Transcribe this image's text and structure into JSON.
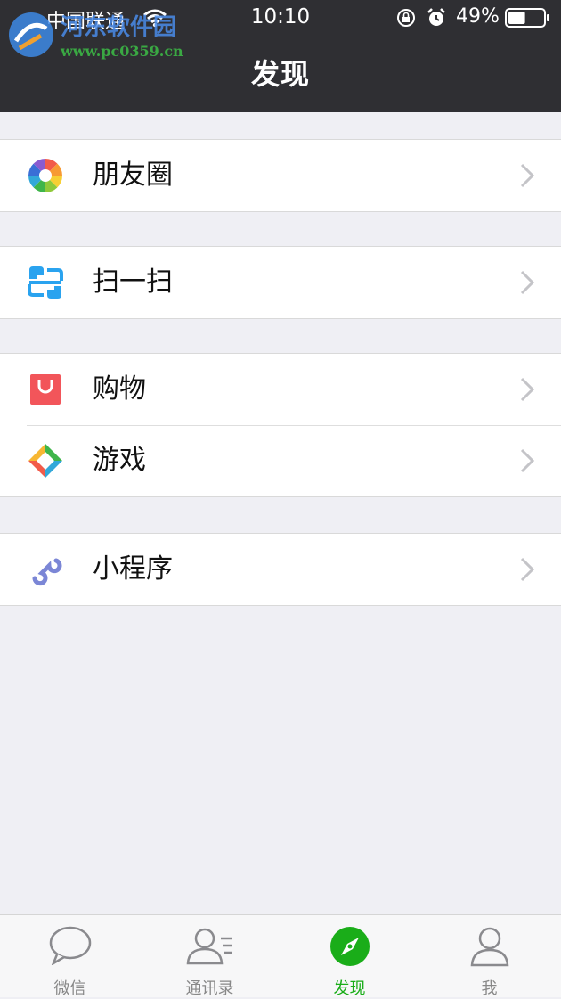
{
  "status_bar": {
    "carrier": "中国联通",
    "time": "10:10",
    "battery": "49%",
    "battery_level": 0.49
  },
  "watermark": {
    "text": "河东软件园",
    "url": "www.pc0359.cn"
  },
  "header": {
    "title": "发现"
  },
  "menu_groups": [
    [
      {
        "label": "朋友圈",
        "icon": "moments-icon"
      }
    ],
    [
      {
        "label": "扫一扫",
        "icon": "scan-icon"
      }
    ],
    [
      {
        "label": "购物",
        "icon": "shopping-icon"
      },
      {
        "label": "游戏",
        "icon": "games-icon"
      }
    ],
    [
      {
        "label": "小程序",
        "icon": "mini-program-icon"
      }
    ]
  ],
  "tabbar": {
    "tabs": [
      {
        "label": "微信",
        "icon": "chat-icon",
        "active": false
      },
      {
        "label": "通讯录",
        "icon": "contacts-icon",
        "active": false
      },
      {
        "label": "发现",
        "icon": "compass-icon",
        "active": true
      },
      {
        "label": "我",
        "icon": "person-icon",
        "active": false
      }
    ]
  },
  "colors": {
    "header_bg": "#2f2f33",
    "page_bg": "#efeff4",
    "active_tab": "#1aad19",
    "shopping_red": "#f2555a",
    "scan_blue": "#2aa3ef",
    "mini_program_purple": "#7b86d6"
  }
}
